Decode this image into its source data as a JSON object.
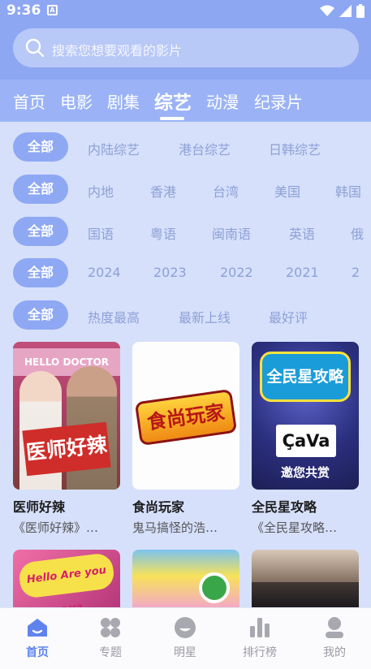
{
  "status": {
    "time": "9:36",
    "notification_letter": "A"
  },
  "search": {
    "placeholder": "搜索您想要观看的影片"
  },
  "tabs": [
    {
      "label": "首页"
    },
    {
      "label": "电影"
    },
    {
      "label": "剧集"
    },
    {
      "label": "综艺",
      "active": true
    },
    {
      "label": "动漫"
    },
    {
      "label": "纪录片"
    }
  ],
  "filters": {
    "genre": {
      "selected": "全部",
      "options": [
        "内陆综艺",
        "港台综艺",
        "日韩综艺"
      ]
    },
    "region": {
      "selected": "全部",
      "options": [
        "内地",
        "香港",
        "台湾",
        "美国",
        "韩国"
      ]
    },
    "language": {
      "selected": "全部",
      "options": [
        "国语",
        "粤语",
        "闽南语",
        "英语",
        "俄"
      ]
    },
    "year": {
      "selected": "全部",
      "options": [
        "2024",
        "2023",
        "2022",
        "2021",
        "2"
      ]
    },
    "sort": {
      "selected": "全部",
      "options": [
        "热度最高",
        "最新上线",
        "最好评"
      ]
    }
  },
  "cards": [
    {
      "title": "医师好辣",
      "subtitle": "《医师好辣》…",
      "poster_text": "医师好辣",
      "poster_top_text": "HELLO DOCTOR"
    },
    {
      "title": "食尚玩家",
      "subtitle": "鬼马搞怪的浩…",
      "poster_text": "食尚玩家"
    },
    {
      "title": "全民星攻略",
      "subtitle": "《全民星攻略…",
      "poster_text": "全民星攻略",
      "poster_badge": "ÇaVa",
      "poster_footer": "邀您共赏"
    }
  ],
  "thumbs": [
    {
      "text": "Hello Are you OK?"
    },
    {
      "text": ""
    },
    {
      "text": ""
    }
  ],
  "bottom_nav": [
    {
      "label": "首页",
      "icon": "home-icon",
      "active": true
    },
    {
      "label": "专题",
      "icon": "grid-icon"
    },
    {
      "label": "明星",
      "icon": "star-face-icon"
    },
    {
      "label": "排行榜",
      "icon": "bar-chart-icon"
    },
    {
      "label": "我的",
      "icon": "user-icon"
    }
  ],
  "colors": {
    "accent": "#8ea8f3",
    "active_nav": "#5f83ee",
    "background": "#d6e0fb"
  }
}
